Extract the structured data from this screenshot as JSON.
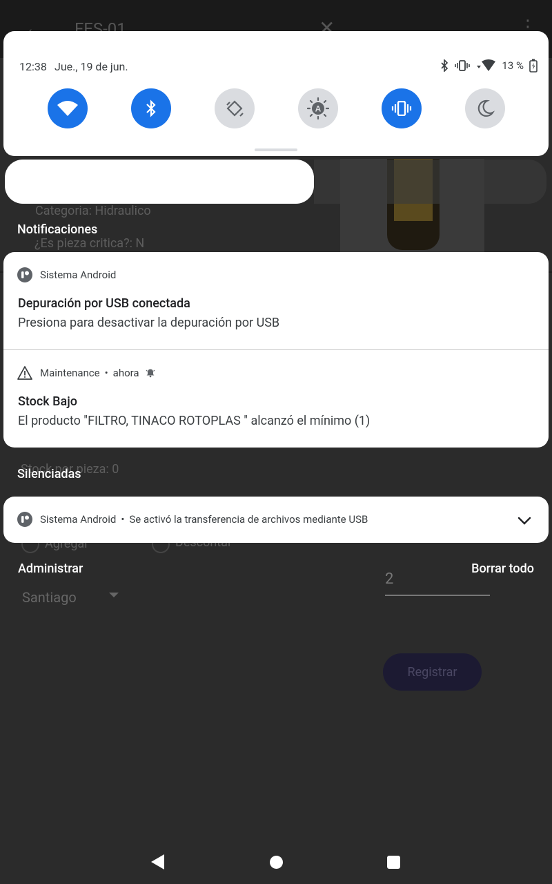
{
  "background_app": {
    "title": "FES-01",
    "lines": [
      "Categoria: Hidraulico",
      "¿Es pieza critica?: N",
      "Stock por pieza: 0"
    ],
    "radio_agregar": "Agregar",
    "radio_descontar": "Descontar",
    "quantity_value": "2",
    "select_value": "Santiago",
    "register_label": "Registrar"
  },
  "quick_settings": {
    "time": "12:38",
    "date": "Jue., 19 de jun.",
    "battery": "13 %",
    "tiles": [
      {
        "name": "wifi",
        "icon": "wifi-icon",
        "on": true
      },
      {
        "name": "bluetooth",
        "icon": "bluetooth-icon",
        "on": true
      },
      {
        "name": "auto-rotate",
        "icon": "rotate-icon",
        "on": false
      },
      {
        "name": "auto-brightness",
        "icon": "brightness-auto-icon",
        "on": false
      },
      {
        "name": "vibrate",
        "icon": "vibrate-icon",
        "on": true
      },
      {
        "name": "night-mode",
        "icon": "moon-icon",
        "on": false
      }
    ],
    "accent_color": "#1a73e8",
    "off_color": "#dadce0"
  },
  "sections": {
    "notifications": "Notificaciones",
    "silenced": "Silenciadas"
  },
  "notifications": [
    {
      "app": "Sistema Android",
      "icon": "android-system-icon",
      "title": "Depuración por USB conectada",
      "text": "Presiona para desactivar la depuración por USB"
    },
    {
      "app": "Maintenance",
      "time": "ahora",
      "icon": "warning-icon",
      "title": "Stock Bajo",
      "text": "El producto \"FILTRO, TINACO ROTOPLAS \" alcanzó el mínimo (1)"
    }
  ],
  "silenced_notification": {
    "app": "Sistema Android",
    "text": "Se activó la transferencia de archivos mediante USB",
    "icon": "android-system-icon"
  },
  "footer": {
    "manage": "Administrar",
    "clear_all": "Borrar todo"
  }
}
